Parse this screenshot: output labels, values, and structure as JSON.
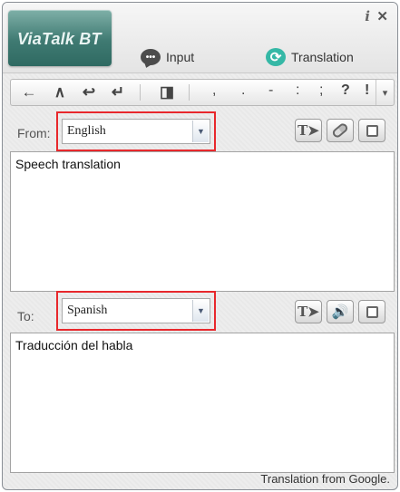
{
  "app": {
    "logo": "ViaTalk BT",
    "info_symbol": "i",
    "close_symbol": "✕"
  },
  "tabs": [
    {
      "label": "Input",
      "icon": "speech-bubble-icon"
    },
    {
      "label": "Translation",
      "icon": "refresh-icon"
    }
  ],
  "toolbar": {
    "buttons": [
      {
        "name": "backspace-left-arrow",
        "glyph": "←"
      },
      {
        "name": "caret-up",
        "glyph": "∧"
      },
      {
        "name": "undo",
        "glyph": "↩"
      },
      {
        "name": "enter",
        "glyph": "↵"
      },
      {
        "name": "split-panel",
        "glyph": "◨"
      }
    ],
    "punctuation": [
      ",",
      ".",
      "-",
      ":",
      ";",
      "?",
      "!"
    ],
    "more": "▾"
  },
  "source": {
    "label": "From:",
    "language": "English",
    "text": "Speech translation"
  },
  "target": {
    "label": "To:",
    "language": "Spanish",
    "text": "Traducción del habla"
  },
  "footer": {
    "note": "Translation from Google."
  },
  "colors": {
    "highlight": "#e8282c",
    "logo": "#3f7a72",
    "translation_icon": "#35b8a6"
  }
}
